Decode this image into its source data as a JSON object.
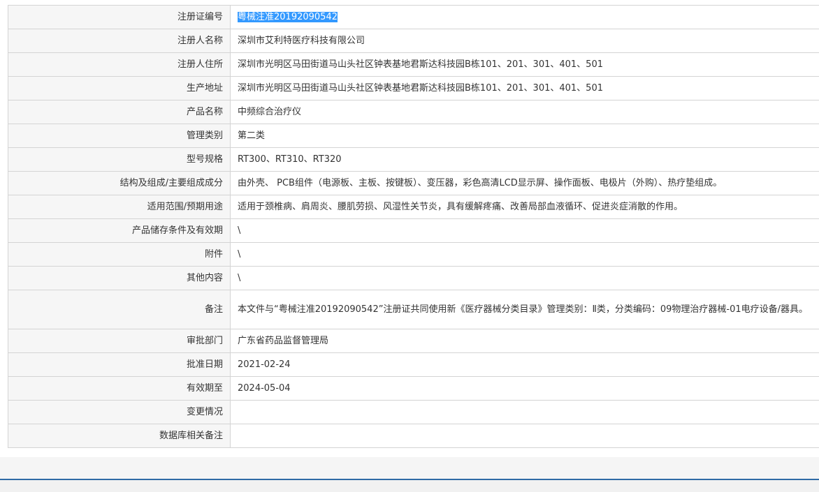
{
  "rows": [
    {
      "label": "注册证编号",
      "value": "粤械注准20192090542"
    },
    {
      "label": "注册人名称",
      "value": "深圳市艾利特医疗科技有限公司"
    },
    {
      "label": "注册人住所",
      "value": "深圳市光明区马田街道马山头社区钟表基地君斯达科技园B栋101、201、301、401、501"
    },
    {
      "label": "生产地址",
      "value": "深圳市光明区马田街道马山头社区钟表基地君斯达科技园B栋101、201、301、401、501"
    },
    {
      "label": "产品名称",
      "value": "中频综合治疗仪"
    },
    {
      "label": "管理类别",
      "value": "第二类"
    },
    {
      "label": "型号规格",
      "value": "RT300、RT310、RT320"
    },
    {
      "label": "结构及组成/主要组成成分",
      "value": "由外壳、 PCB组件（电源板、主板、按键板）、变压器，彩色高清LCD显示屏、操作面板、电极片（外购）、热疗垫组成。"
    },
    {
      "label": "适用范围/预期用途",
      "value": "适用于颈椎病、肩周炎、腰肌劳损、风湿性关节炎，具有缓解疼痛、改善局部血液循环、促进炎症消散的作用。"
    },
    {
      "label": "产品储存条件及有效期",
      "value": "\\"
    },
    {
      "label": "附件",
      "value": "\\"
    },
    {
      "label": "其他内容",
      "value": "\\"
    },
    {
      "label": "备注",
      "value": "本文件与“粤械注准20192090542”注册证共同使用新《医疗器械分类目录》管理类别：Ⅱ类，分类编码：09物理治疗器械-01电疗设备/器具。"
    },
    {
      "label": "审批部门",
      "value": "广东省药品监督管理局"
    },
    {
      "label": "批准日期",
      "value": "2021-02-24"
    },
    {
      "label": "有效期至",
      "value": "2024-05-04"
    },
    {
      "label": "变更情况",
      "value": ""
    },
    {
      "label": "数据库相关备注",
      "value": ""
    }
  ],
  "colors": {
    "label_bg": "#f6f6f6",
    "border": "#d4d4d4",
    "selection": "#3399ff",
    "bottom_accent": "#2f6aa6"
  }
}
